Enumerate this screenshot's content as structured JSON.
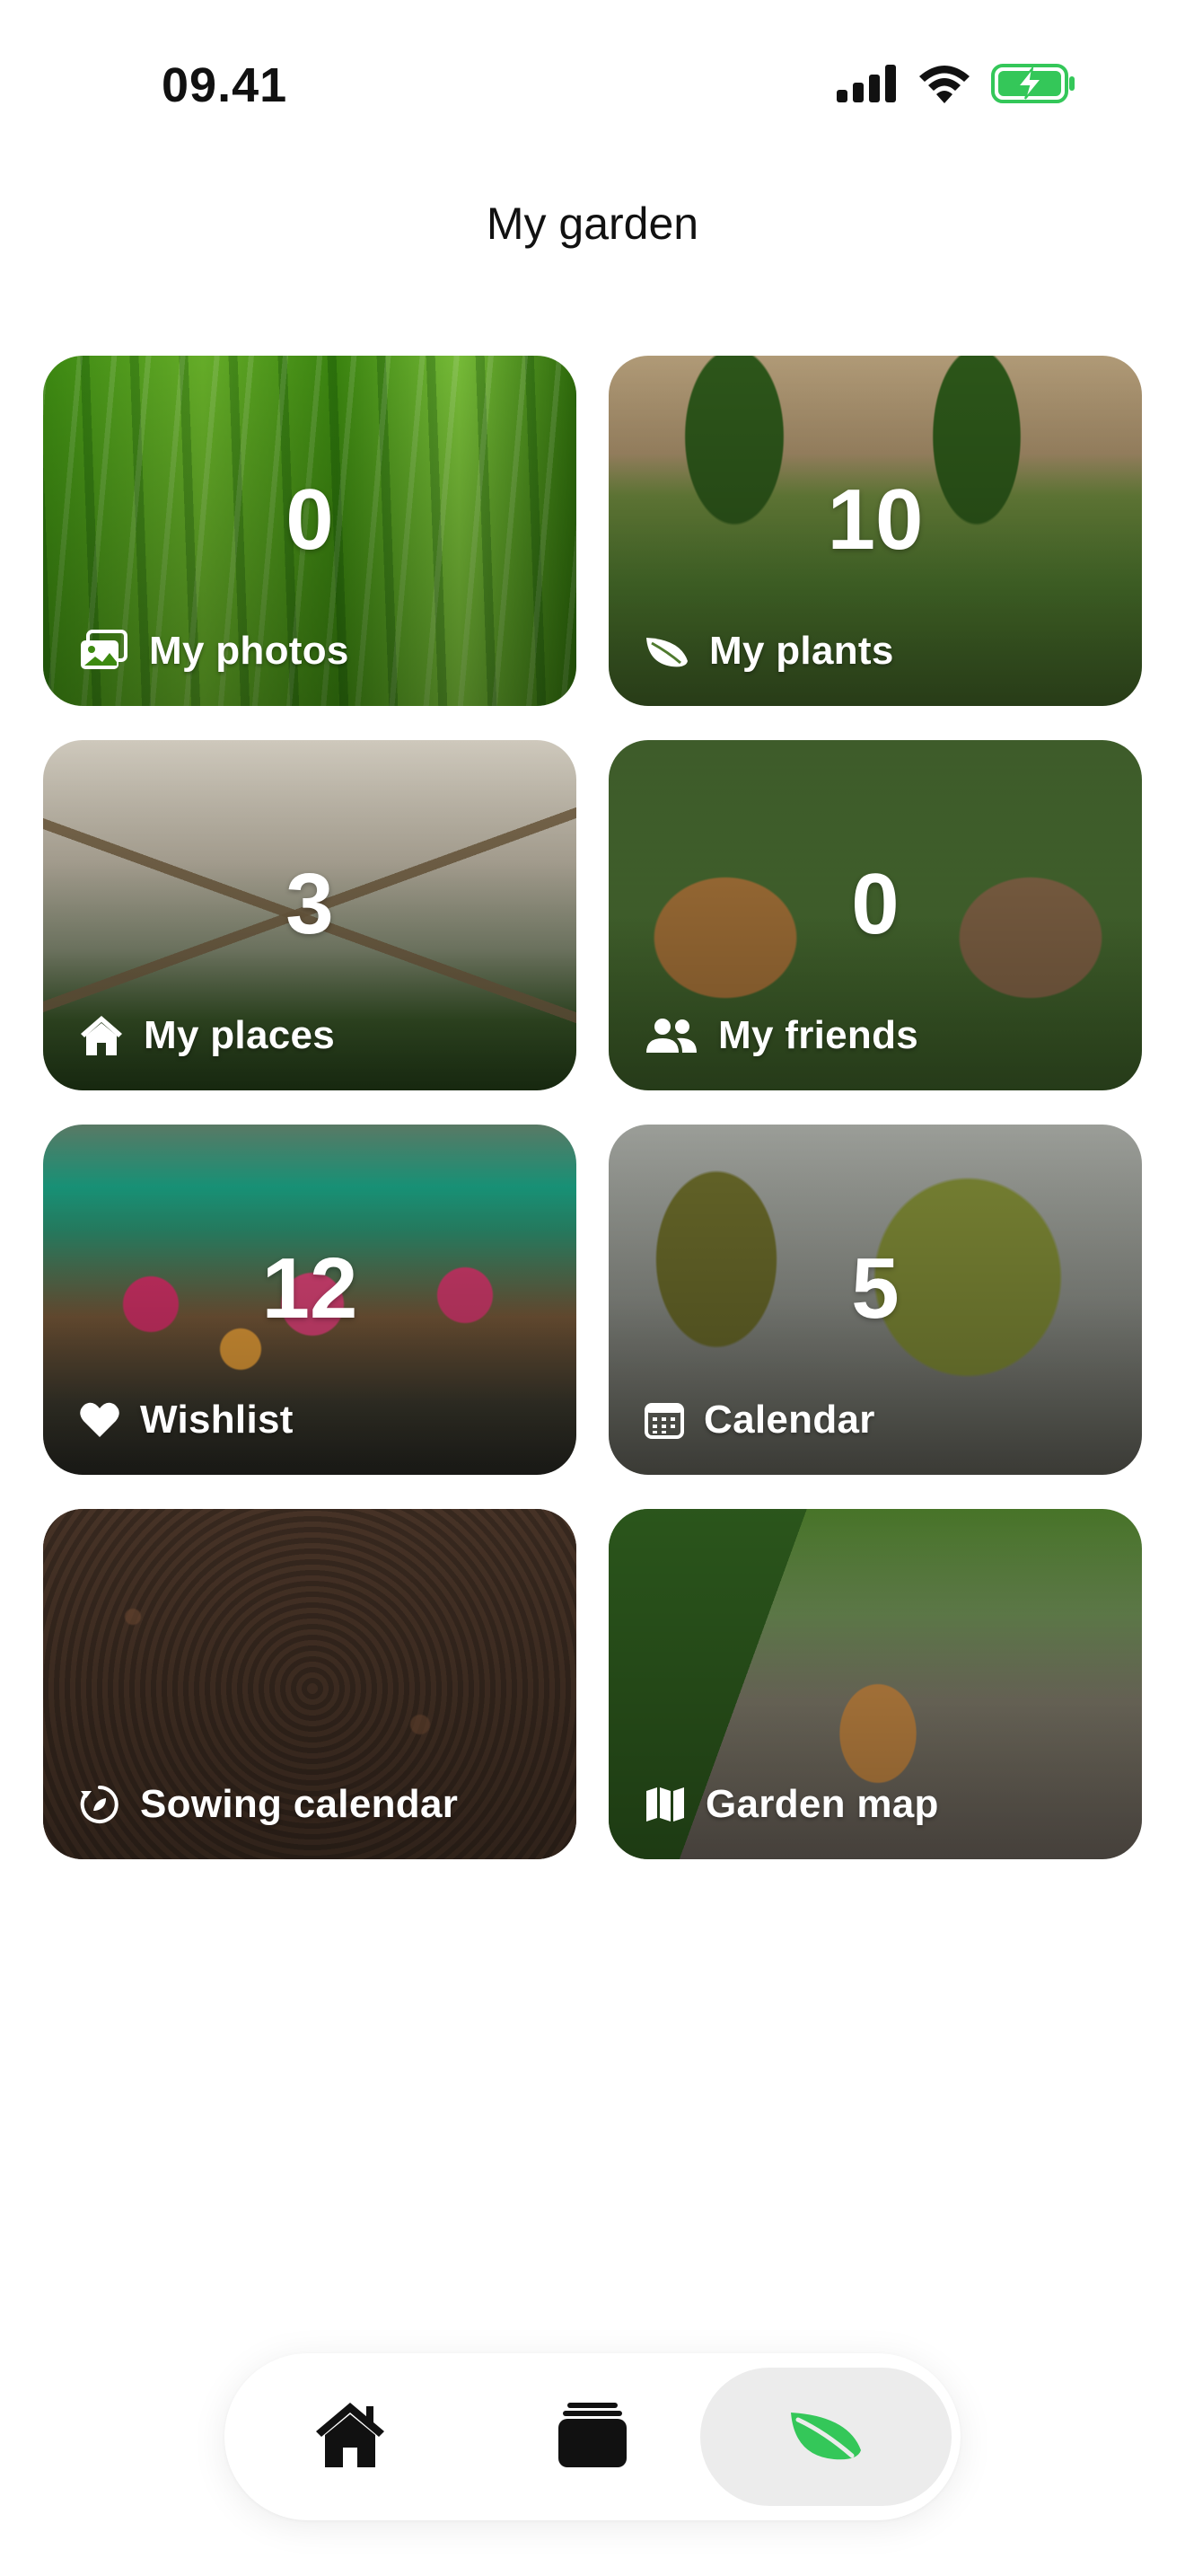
{
  "status_bar": {
    "time": "09.41",
    "icons": [
      "cellular-signal-icon",
      "wifi-icon",
      "battery-charging-icon"
    ],
    "battery_color": "#34c759"
  },
  "header": {
    "title": "My garden"
  },
  "tiles": [
    {
      "label": "My photos",
      "count": "0",
      "icon": "photos-icon"
    },
    {
      "label": "My plants",
      "count": "10",
      "icon": "leaf-icon"
    },
    {
      "label": "My places",
      "count": "3",
      "icon": "house-icon"
    },
    {
      "label": "My friends",
      "count": "0",
      "icon": "people-icon"
    },
    {
      "label": "Wishlist",
      "count": "12",
      "icon": "heart-icon"
    },
    {
      "label": "Calendar",
      "count": "5",
      "icon": "calendar-icon"
    },
    {
      "label": "Sowing calendar",
      "count": "",
      "icon": "sowing-cycle-icon"
    },
    {
      "label": "Garden map",
      "count": "",
      "icon": "map-icon"
    }
  ],
  "tabbar": {
    "tabs": [
      {
        "icon": "home-icon",
        "active": false
      },
      {
        "icon": "stack-icon",
        "active": false
      },
      {
        "icon": "leaf-icon",
        "active": true
      }
    ],
    "active_color": "#34c759",
    "inactive_color": "#111111"
  }
}
